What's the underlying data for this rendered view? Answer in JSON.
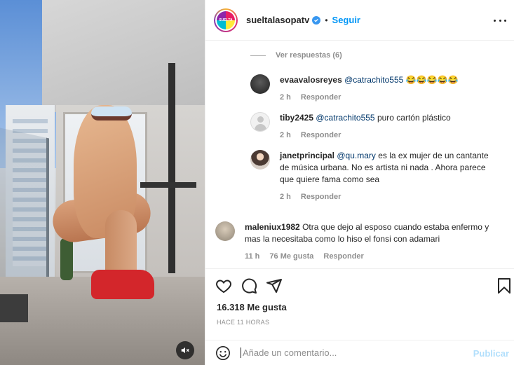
{
  "post": {
    "header": {
      "username": "sueltalasopatv",
      "verified": true,
      "separator": "•",
      "follow_label": "Seguir",
      "more_icon": "more-dots-icon"
    },
    "comments": {
      "view_replies": "Ver respuestas (6)",
      "items": [
        {
          "username": "evaavalosreyes",
          "mention": "@catrachito555",
          "text": "😂😂😂😂😂",
          "time": "2 h",
          "reply": "Responder",
          "likes": ""
        },
        {
          "username": "tiby2425",
          "mention": "@catrachito555",
          "text": "puro cartón plástico",
          "time": "2 h",
          "reply": "Responder",
          "likes": ""
        },
        {
          "username": "janetprincipal",
          "mention": "@qu.mary",
          "text": "es la ex mujer de un cantante de música urbana. No es artista ni nada . Ahora parece que quiere fama como sea",
          "time": "2 h",
          "reply": "Responder",
          "likes": ""
        },
        {
          "username": "maleniux1982",
          "mention": "",
          "text": "Otra que dejo al esposo cuando estaba enfermo y mas la necesitaba como lo hiso el fonsi con adamari",
          "time": "11 h",
          "reply": "Responder",
          "likes": "76 Me gusta"
        }
      ]
    },
    "actions": {
      "like_icon": "heart-icon",
      "comment_icon": "comment-bubble-icon",
      "share_icon": "send-icon",
      "save_icon": "bookmark-icon"
    },
    "likes_label": "16.318 Me gusta",
    "timestamp": "HACE 11 HORAS",
    "add_comment": {
      "placeholder": "Añade un comentario...",
      "publish_label": "Publicar",
      "emoji_icon": "emoji-smile-icon"
    },
    "media": {
      "mute_icon": "speaker-muted-icon"
    },
    "colors": {
      "link_blue": "#0095f6",
      "mention_blue": "#00376b",
      "muted_gray": "#8e8e8e",
      "publish_disabled": "#b2dffc"
    }
  }
}
